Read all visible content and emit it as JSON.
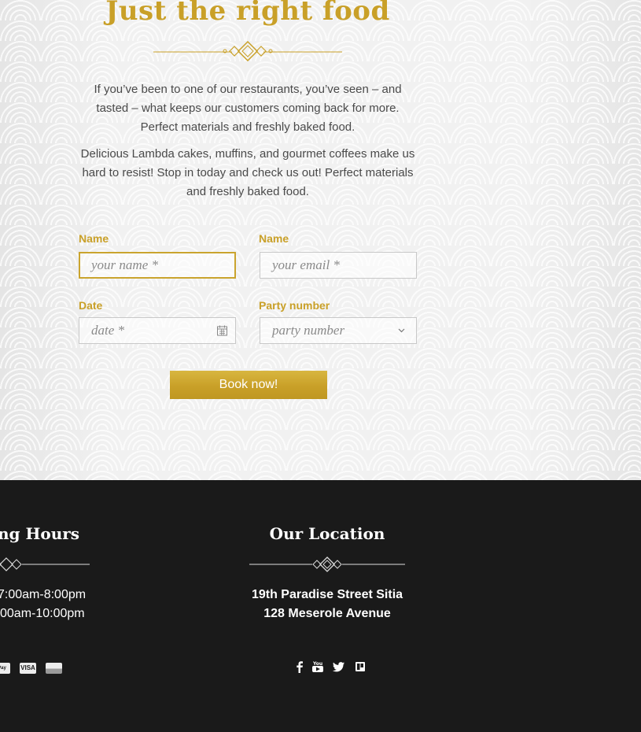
{
  "hero": {
    "title": "Just the right food",
    "paragraph1": "If you’ve been to one of our restaurants, you’ve seen – and tasted – what keeps our customers coming back for more. Perfect materials and freshly baked food.",
    "paragraph2": "Delicious Lambda cakes,  muffins, and gourmet coffees make us hard to resist! Stop in today and check us out! Perfect materials and freshly baked food."
  },
  "form": {
    "name_label": "Name",
    "name_placeholder": "your name *",
    "email_label": "Name",
    "email_placeholder": "your email *",
    "date_label": "Date",
    "date_placeholder": "date *",
    "party_label": "Party number",
    "party_placeholder": "party number",
    "submit_label": "Book now!"
  },
  "footer": {
    "hours": {
      "heading": "ng Hours",
      "line1": "7:00am-8:00pm",
      "line2": "00am-10:00pm"
    },
    "location": {
      "heading": "Our Location",
      "line1": "19th Paradise Street Sitia",
      "line2": "128 Meserole Avenue"
    },
    "payment_icons": [
      "paypal-icon",
      "visa-icon",
      "discover-icon"
    ],
    "payment_labels": {
      "visa": "VISA"
    },
    "social_icons": [
      "facebook-icon",
      "youtube-icon",
      "twitter-icon",
      "trello-icon"
    ]
  },
  "colors": {
    "accent_gold": "#c9a028",
    "footer_bg": "#1a1a1a",
    "hero_bg": "#f1f1f1"
  }
}
